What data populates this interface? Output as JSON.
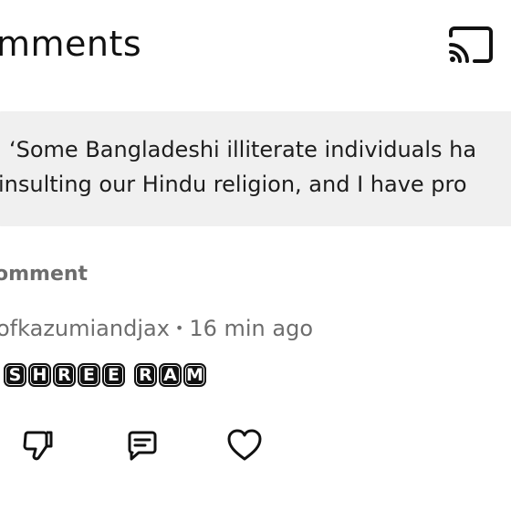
{
  "header": {
    "title": "mments"
  },
  "quote": {
    "line1": "‘Some Bangladeshi illiterate individuals ha",
    "line2": "insulting our Hindu religion, and I have pro"
  },
  "section": {
    "label": "omment"
  },
  "comment": {
    "author": "ofkazumiandjax",
    "separator": "•",
    "time": "16 min ago",
    "letters": [
      "S",
      "H",
      "R",
      "E",
      "E",
      " ",
      "R",
      "A",
      "M"
    ]
  },
  "icons": {
    "cast": "cast-icon",
    "dislike": "thumbs-down-icon",
    "reply": "comment-icon",
    "like": "heart-icon"
  },
  "colors": {
    "text": "#1a1a1a",
    "muted": "#6d6d6d",
    "quote_bg": "#f0f0f0",
    "tile": "#111111"
  }
}
